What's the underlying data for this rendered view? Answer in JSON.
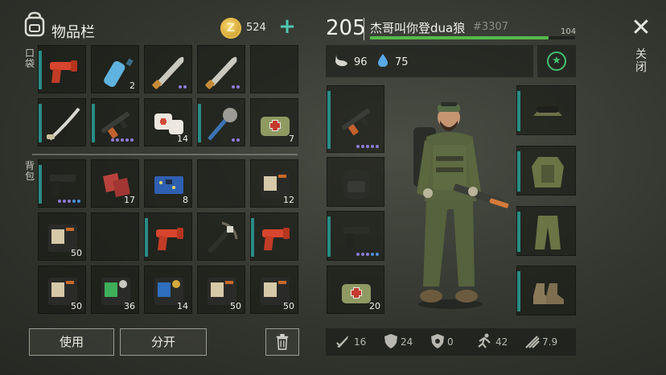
{
  "inventory": {
    "title": "物品栏",
    "coins": "524",
    "pocket_label": "口袋",
    "backpack_label": "背包",
    "pocket_slots": [
      {
        "item": "flare-gun",
        "qty": ""
      },
      {
        "item": "water-bottle",
        "qty": "2"
      },
      {
        "item": "machete",
        "qty": ""
      },
      {
        "item": "machete",
        "qty": ""
      },
      {
        "item": "empty",
        "qty": ""
      },
      {
        "item": "katana",
        "qty": ""
      },
      {
        "item": "assault-rifle",
        "qty": ""
      },
      {
        "item": "bandage",
        "qty": "14"
      },
      {
        "item": "spiked-mace",
        "qty": ""
      },
      {
        "item": "medkit-bag",
        "qty": "7"
      }
    ],
    "backpack_slots": [
      {
        "item": "pistol",
        "qty": ""
      },
      {
        "item": "red-cloth",
        "qty": "17"
      },
      {
        "item": "circuit-board",
        "qty": "8"
      },
      {
        "item": "empty",
        "qty": ""
      },
      {
        "item": "wallet",
        "qty": "12"
      },
      {
        "item": "wallet",
        "qty": "50"
      },
      {
        "item": "empty",
        "qty": ""
      },
      {
        "item": "flare-gun",
        "qty": ""
      },
      {
        "item": "crossbow",
        "qty": ""
      },
      {
        "item": "flare-gun",
        "qty": ""
      },
      {
        "item": "wallet",
        "qty": "50"
      },
      {
        "item": "green-wallet",
        "qty": "36"
      },
      {
        "item": "blue-wallet",
        "qty": "14"
      },
      {
        "item": "wallet",
        "qty": "50"
      },
      {
        "item": "wallet",
        "qty": "50"
      }
    ],
    "use_label": "使用",
    "split_label": "分开"
  },
  "player": {
    "level": "205",
    "name": "杰哥叫你登dua狼",
    "id": "#3307",
    "xp_max": "104",
    "xp_fraction": 0.87,
    "food": "96",
    "water": "75"
  },
  "equipment": {
    "weapon_slots": [
      {
        "item": "assault-rifle",
        "qty": ""
      },
      {
        "item": "backpack",
        "qty": ""
      },
      {
        "item": "pistol",
        "qty": ""
      },
      {
        "item": "medkit-bag",
        "qty": "20"
      }
    ],
    "armor_slots": [
      "cap-goggles",
      "camo-vest",
      "camo-pants",
      "boots"
    ]
  },
  "stats": {
    "attack": "16",
    "defense": "24",
    "radiation": "0",
    "speed": "42",
    "stealth": "7.9"
  },
  "close_label": "关闭",
  "colors": {
    "accent": "#2a8c86",
    "xp": "#55b94a",
    "coin": "#e6b94a",
    "plus": "#4fc7b3"
  }
}
